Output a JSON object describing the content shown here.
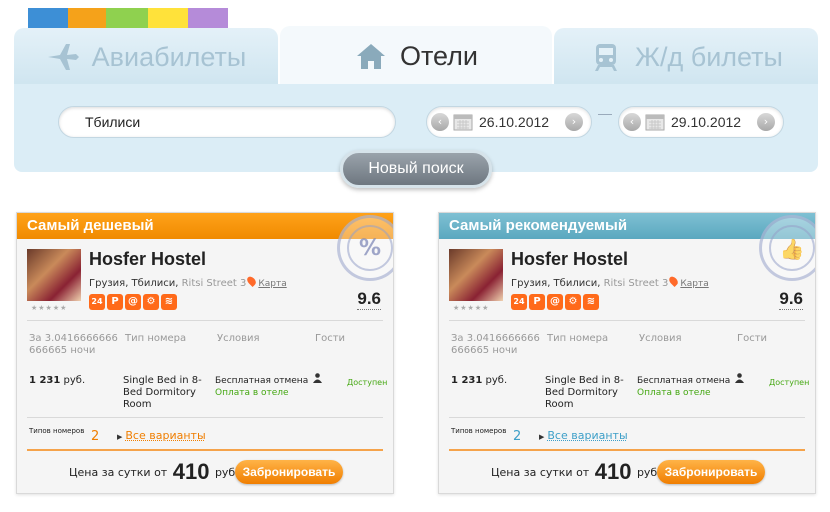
{
  "nav": {
    "tabs": [
      {
        "label": "Авиабилеты",
        "icon": "airplane-icon"
      },
      {
        "label": "Отели",
        "icon": "house-icon"
      },
      {
        "label": "Ж/д билеты",
        "icon": "train-icon"
      }
    ],
    "active_tab": "Отели"
  },
  "search": {
    "city": "Тбилиси",
    "checkin": "26.10.2012",
    "checkout": "29.10.2012",
    "button_label": "Новый поиск"
  },
  "cards": [
    {
      "header": "Самый дешевый",
      "header_color": "#f5920f",
      "stamp": "%",
      "hotel_name": "Hosfer Hostel",
      "address": "Грузия, Тбилиси,",
      "street": "Ritsi Street 3",
      "map_label": "Карта",
      "amenities": [
        "24",
        "P",
        "@",
        "⚙",
        "≋"
      ],
      "rating": "9.6",
      "headers": {
        "period": "За 3.0416666666666665 ночи",
        "room_type": "Тип номера",
        "conditions": "Условия",
        "guests": "Гости"
      },
      "price": "1 231",
      "price_unit": "руб.",
      "room": "Single Bed in 8-Bed Dormitory Room",
      "cancel": "Бесплатная отмена",
      "payment": "Оплата в отеле",
      "availability": "Доступен",
      "room_types_label": "Типов номеров",
      "room_types_count": "2",
      "variants_link": "Все варианты",
      "count_color": "#f07e00",
      "link_color": "#f07e00",
      "total_prefix": "Цена за сутки от",
      "total_price": "410",
      "total_unit": "руб.",
      "book_label": "Забронировать"
    },
    {
      "header": "Самый рекомендуемый",
      "header_color": "#67b1c6",
      "stamp": "👍",
      "hotel_name": "Hosfer Hostel",
      "address": "Грузия, Тбилиси,",
      "street": "Ritsi Street 3",
      "map_label": "Карта",
      "amenities": [
        "24",
        "P",
        "@",
        "⚙",
        "≋"
      ],
      "rating": "9.6",
      "headers": {
        "period": "За 3.0416666666666665 ночи",
        "room_type": "Тип номера",
        "conditions": "Условия",
        "guests": "Гости"
      },
      "price": "1 231",
      "price_unit": "руб.",
      "room": "Single Bed in 8-Bed Dormitory Room",
      "cancel": "Бесплатная отмена",
      "payment": "Оплата в отеле",
      "availability": "Доступен",
      "room_types_label": "Типов номеров",
      "room_types_count": "2",
      "variants_link": "Все варианты",
      "count_color": "#3d9fc8",
      "link_color": "#3d9fc8",
      "total_prefix": "Цена за сутки от",
      "total_price": "410",
      "total_unit": "руб.",
      "book_label": "Забронировать"
    }
  ],
  "colors": {
    "accent_orange": "#f07e00",
    "accent_blue": "#5aa8bf",
    "panel_blue": "#dbedf6",
    "available_green": "#45a812"
  }
}
